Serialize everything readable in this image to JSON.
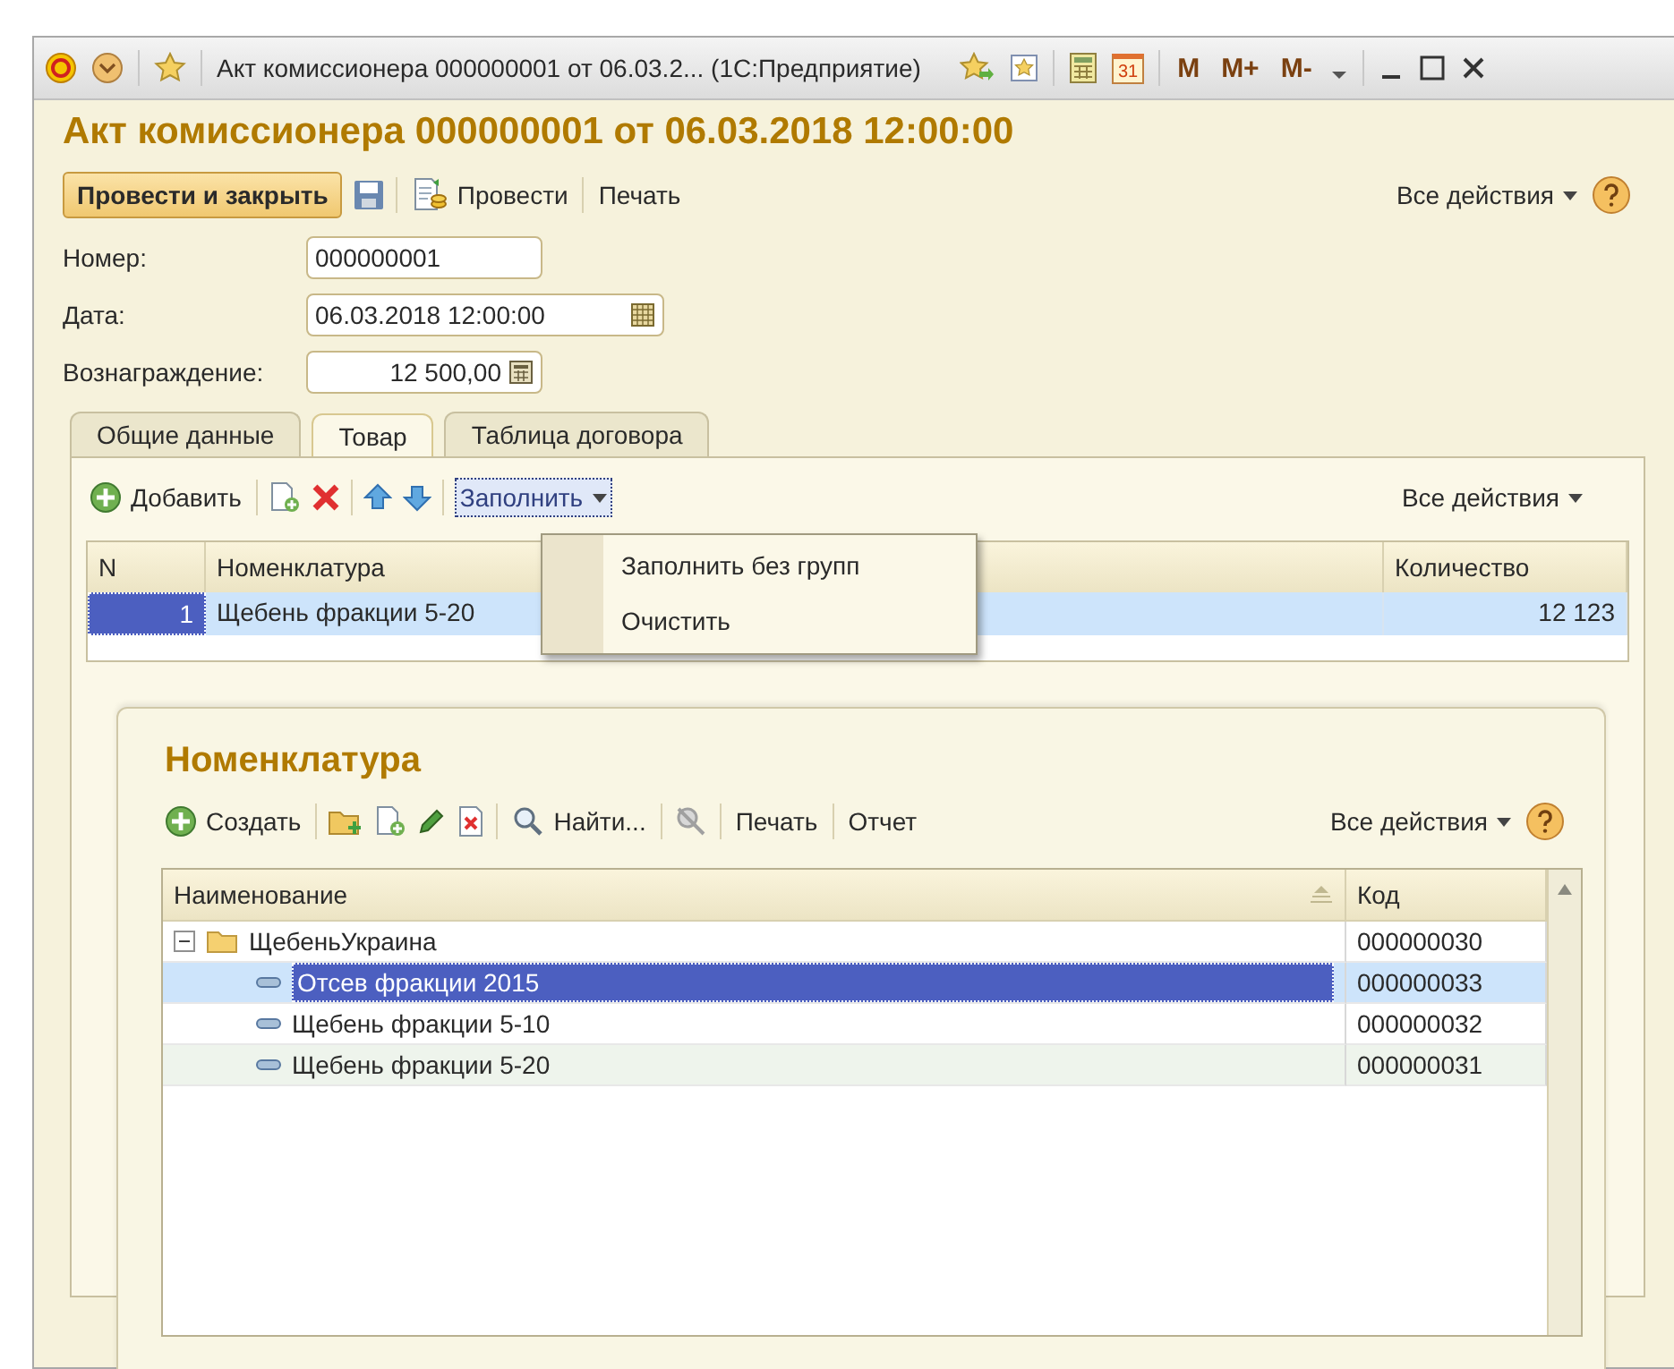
{
  "window": {
    "title": "Акт комиссионера 000000001 от 06.03.2... (1С:Предприятие)",
    "calendar_day": "31",
    "memory_buttons": [
      "M",
      "M+",
      "M-"
    ]
  },
  "form": {
    "title": "Акт комиссионера 000000001 от 06.03.2018 12:00:00",
    "toolbar": {
      "primary": "Провести и закрыть",
      "post": "Провести",
      "print": "Печать",
      "all_actions": "Все действия"
    }
  },
  "fields": [
    {
      "label": "Номер:",
      "value": "000000001",
      "kind": "text"
    },
    {
      "label": "Дата:",
      "value": "06.03.2018 12:00:00",
      "kind": "date"
    },
    {
      "label": "Вознаграждение:",
      "value": "12 500,00",
      "kind": "number"
    }
  ],
  "tabs": [
    {
      "label": "Общие данные",
      "selected": false
    },
    {
      "label": "Товар",
      "selected": true
    },
    {
      "label": "Таблица договора",
      "selected": false
    }
  ],
  "goods": {
    "toolbar": {
      "add": "Добавить",
      "fill": "Заполнить",
      "all_actions": "Все действия"
    },
    "fill_menu": [
      "Заполнить без групп",
      "Очистить"
    ],
    "columns": [
      "N",
      "Номенклатура",
      "Количество"
    ],
    "rows": [
      {
        "n": "1",
        "name": "Щебень фракции 5-20",
        "qty": "12 123",
        "selected": true
      }
    ]
  },
  "catalog": {
    "title": "Номенклатура",
    "toolbar": {
      "create": "Создать",
      "find": "Найти...",
      "print": "Печать",
      "report": "Отчет",
      "all_actions": "Все действия"
    },
    "columns": [
      "Наименование",
      "Код"
    ],
    "rows": [
      {
        "kind": "group",
        "name": "ЩебеньУкраина",
        "code": "000000030",
        "expanded": true,
        "selected": false,
        "children": [
          {
            "kind": "item",
            "name": "Отсев фракции 2015",
            "code": "000000033",
            "selected": true
          },
          {
            "kind": "item",
            "name": "Щебень фракции 5-10",
            "code": "000000032",
            "selected": false
          },
          {
            "kind": "item",
            "name": "Щебень фракции 5-20",
            "code": "000000031",
            "selected": false
          }
        ]
      }
    ]
  }
}
